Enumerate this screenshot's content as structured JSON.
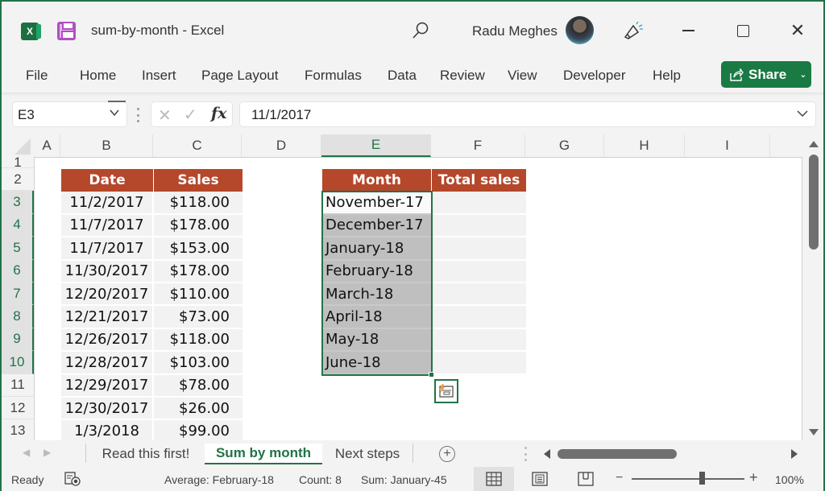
{
  "titlebar": {
    "app_icon": "excel-icon",
    "save_icon": "save-icon",
    "title": "sum-by-month  -  Excel",
    "search_icon": "search-icon",
    "user_name": "Radu Meghes",
    "feedback_icon": "megaphone-icon",
    "window_controls": [
      "minimize",
      "maximize",
      "close"
    ]
  },
  "ribbon": {
    "tabs": [
      "File",
      "Home",
      "Insert",
      "Page Layout",
      "Formulas",
      "Data",
      "Review",
      "View",
      "Developer",
      "Help"
    ],
    "share_label": "Share",
    "share_color": "#1a7a43"
  },
  "formula_bar": {
    "name_box": "E3",
    "cancel_glyph": "✕",
    "enter_glyph": "✓",
    "fx_label": "fx",
    "formula": "11/1/2017"
  },
  "grid": {
    "columns": [
      "A",
      "B",
      "C",
      "D",
      "E",
      "F",
      "G",
      "H",
      "I"
    ],
    "selected_column": "E",
    "rows": [
      "1",
      "2",
      "3",
      "4",
      "5",
      "6",
      "7",
      "8",
      "9",
      "10",
      "11",
      "12",
      "13"
    ],
    "selected_rows": [
      "3",
      "4",
      "5",
      "6",
      "7",
      "8",
      "9",
      "10"
    ],
    "header_color": "#b5472b",
    "accent_color": "#217346",
    "sales_table": {
      "headers": [
        "Date",
        "Sales"
      ],
      "rows": [
        [
          "11/2/2017",
          "$118.00"
        ],
        [
          "11/7/2017",
          "$178.00"
        ],
        [
          "11/7/2017",
          "$153.00"
        ],
        [
          "11/30/2017",
          "$178.00"
        ],
        [
          "12/20/2017",
          "$110.00"
        ],
        [
          "12/21/2017",
          "$73.00"
        ],
        [
          "12/26/2017",
          "$118.00"
        ],
        [
          "12/28/2017",
          "$103.00"
        ],
        [
          "12/29/2017",
          "$78.00"
        ],
        [
          "12/30/2017",
          "$26.00"
        ],
        [
          "1/3/2018",
          "$99.00"
        ]
      ]
    },
    "month_table": {
      "headers": [
        "Month",
        "Total sales"
      ],
      "months": [
        "November-17",
        "December-17",
        "January-18",
        "February-18",
        "March-18",
        "April-18",
        "May-18",
        "June-18"
      ],
      "totals": [
        "",
        "",
        "",
        "",
        "",
        "",
        "",
        ""
      ]
    },
    "flash_fill_icon": "quick-analysis-icon"
  },
  "sheets": {
    "tabs": [
      "Read this first!",
      "Sum by month",
      "Next steps"
    ],
    "active": "Sum by month",
    "add_label": "+"
  },
  "status": {
    "mode": "Ready",
    "average": "Average: February-18",
    "count": "Count: 8",
    "sum": "Sum: January-45",
    "zoom": "100%",
    "zoom_percent": 100
  }
}
